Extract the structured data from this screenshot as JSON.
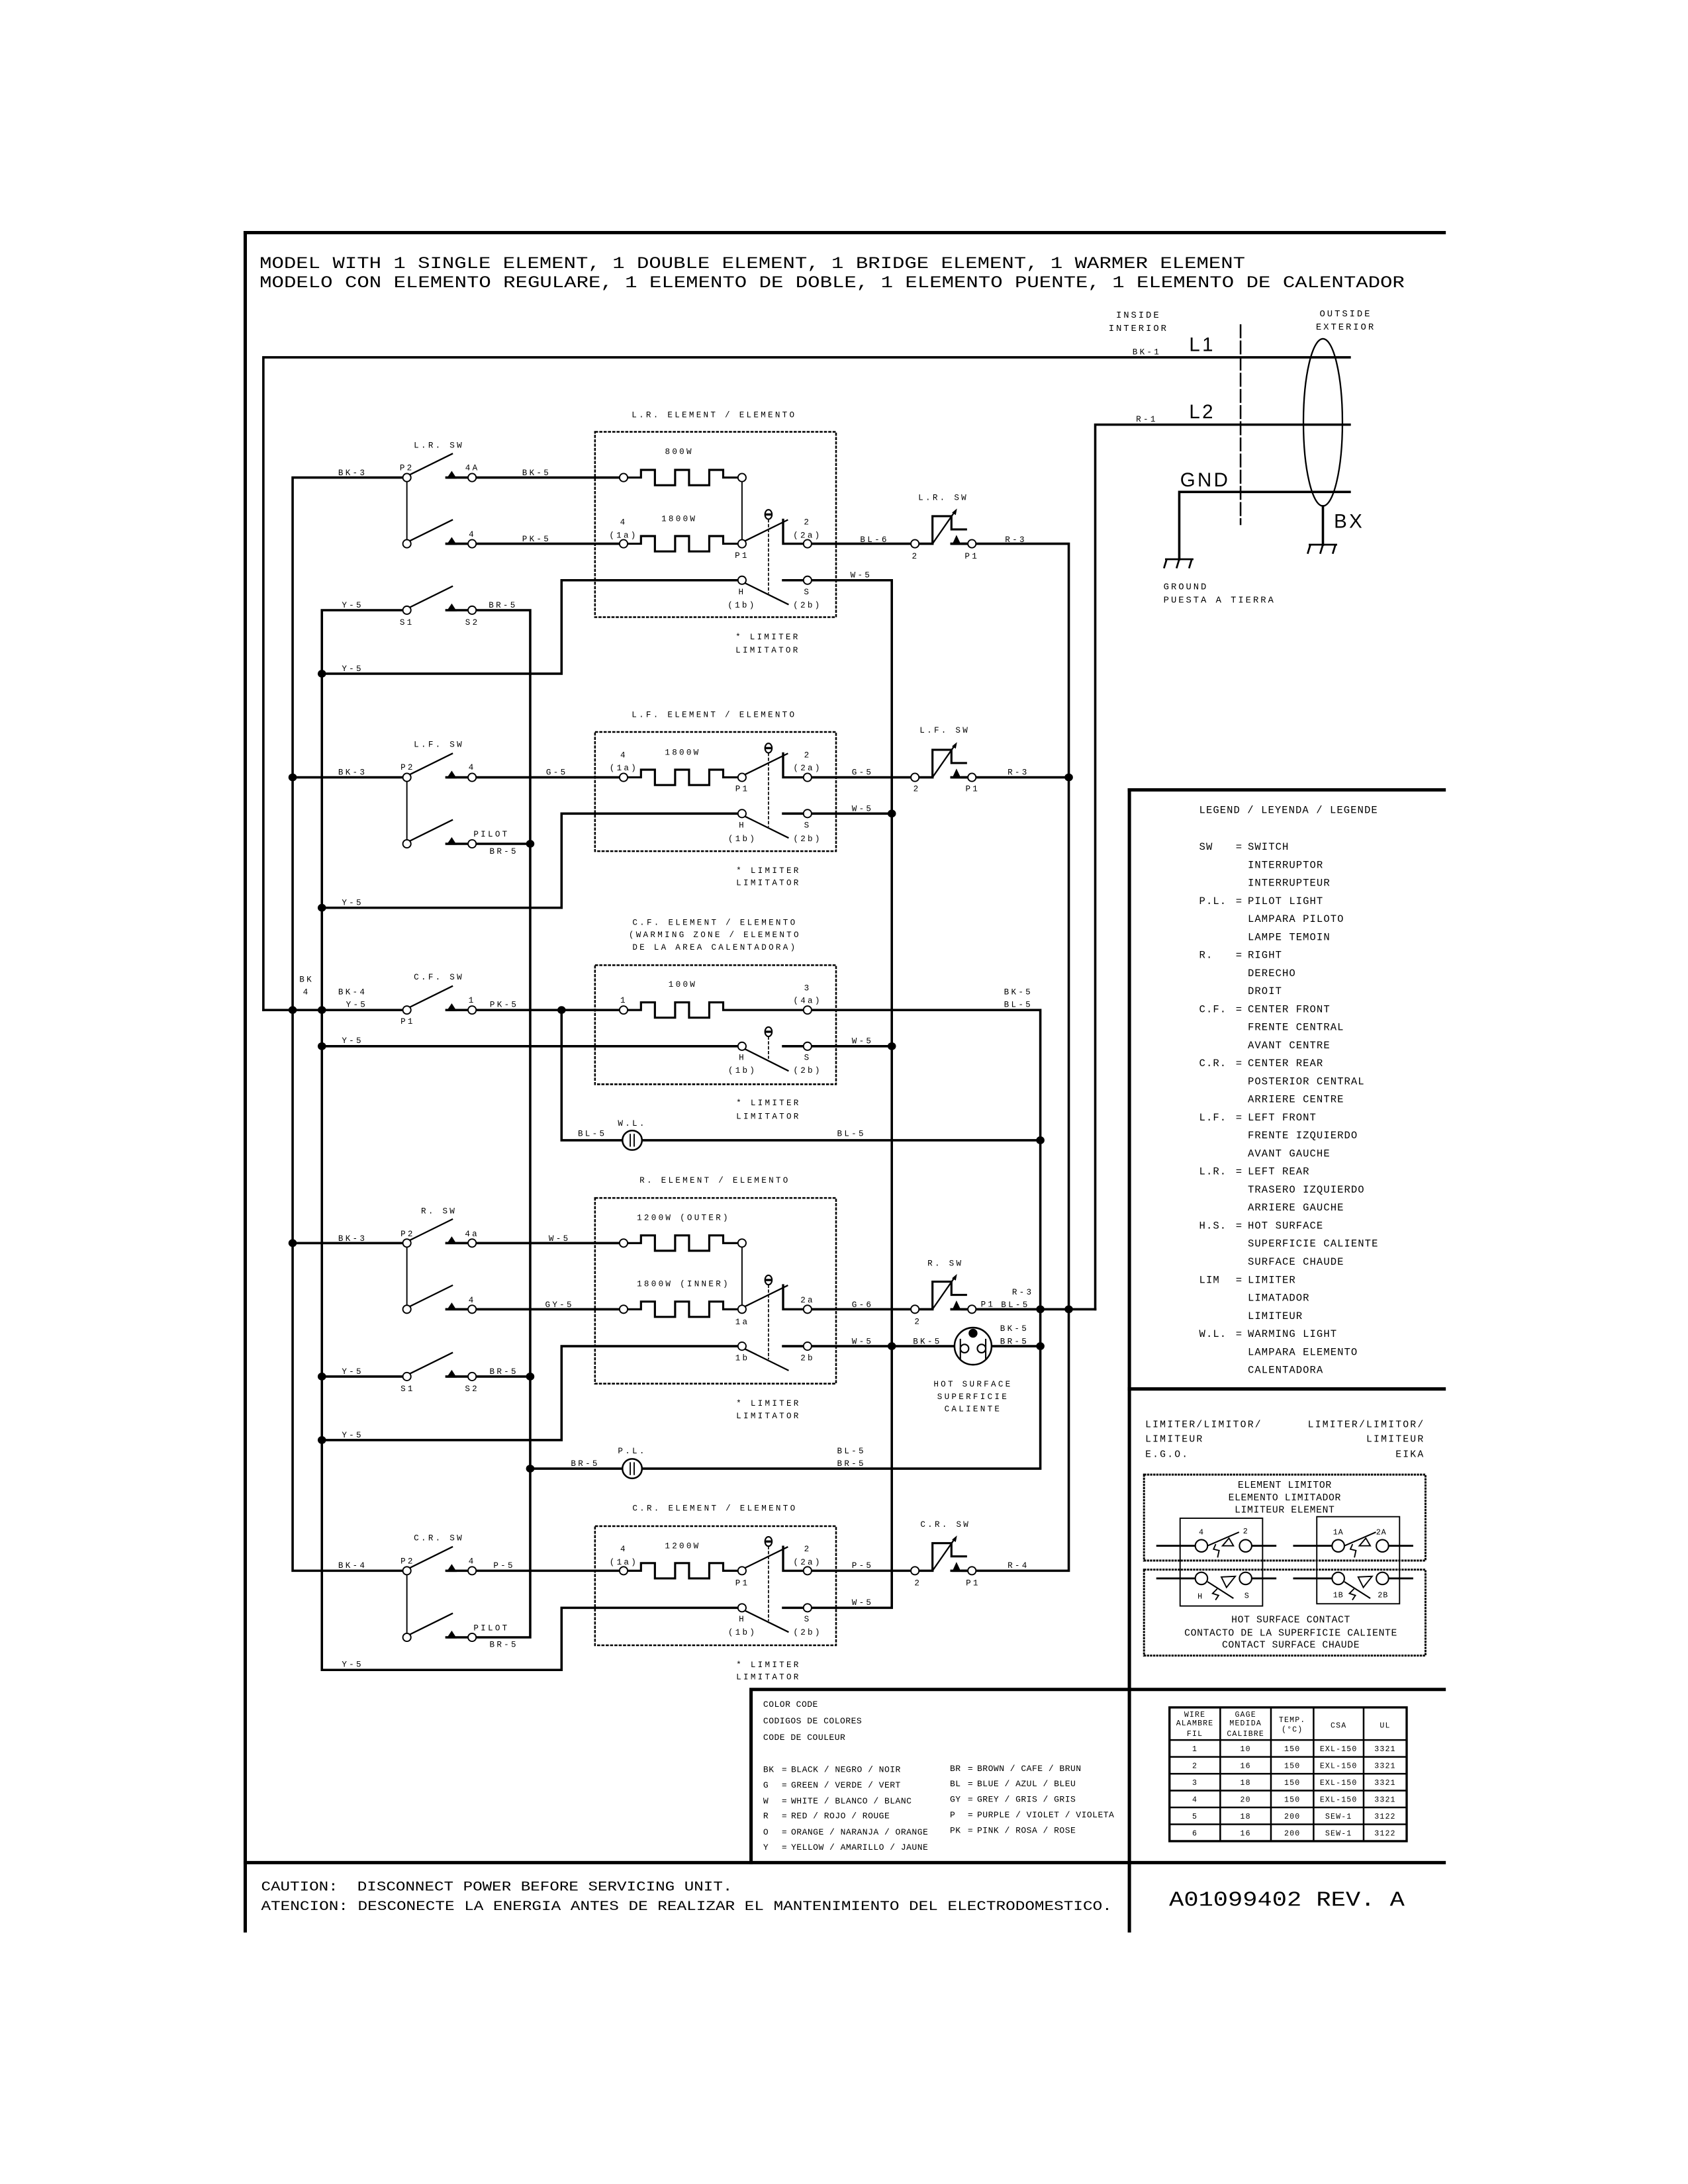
{
  "document": {
    "title_en": "MODEL WITH 1 SINGLE ELEMENT, 1 DOUBLE ELEMENT, 1 BRIDGE ELEMENT, 1 WARMER ELEMENT",
    "title_es": "MODELO CON ELEMENTO REGULARE, 1 ELEMENTO DE DOBLE, 1 ELEMENTO PUENTE, 1 ELEMENTO DE CALENTADOR",
    "caution_en": "CAUTION:  DISCONNECT POWER BEFORE SERVICING UNIT.",
    "caution_es": "ATENCION: DESCONECTE LA ENERGIA ANTES DE REALIZAR EL MANTENIMIENTO DEL ELECTRODOMESTICO.",
    "part_number": "A01099402 REV. A"
  },
  "power": {
    "inside": [
      "INSIDE",
      "INTERIOR"
    ],
    "outside": [
      "OUTSIDE",
      "EXTERIOR"
    ],
    "l1": "L1",
    "l1_wire": "BK-1",
    "l2": "L2",
    "l2_wire": "R-1",
    "gnd": "GND",
    "bx": "BX",
    "ground": [
      "GROUND",
      "PUESTA A TIERRA"
    ]
  },
  "sections": {
    "lr": {
      "title": "L.R. ELEMENT / ELEMENTO",
      "switch": "L.R. SW",
      "thermo_switch": "L.R. SW",
      "heaters": [
        "800W",
        "1800W"
      ],
      "wires": {
        "bus_in": "BK-3",
        "to_outer": "BK-5",
        "to_inner": "PK-5",
        "out": "BL-6",
        "return": "R-3",
        "neutral": "W-5",
        "sense_in": "Y-5",
        "sense_out": "BR-5",
        "sense_bottom": "Y-5"
      },
      "terminals": {
        "switch_p2": "P2",
        "switch_outer": "4A",
        "switch_inner": "4",
        "elem_in": "4",
        "elem_in_alt": "(1a)",
        "elem_p1": "P1",
        "elem_out": "2",
        "elem_out_alt": "(2a)",
        "h": "H",
        "h_alt": "(1b)",
        "s": "S",
        "s_alt": "(2b)",
        "s1": "S1",
        "s2": "S2",
        "thermo_in": "2",
        "thermo_out": "P1"
      },
      "limiter_note": [
        "* LIMITER",
        "LIMITATOR"
      ]
    },
    "lf": {
      "title": "L.F. ELEMENT / ELEMENTO",
      "switch": "L.F. SW",
      "thermo_switch": "L.F. SW",
      "heaters": [
        "1800W"
      ],
      "wires": {
        "bus_in": "BK-3",
        "to_elem": "G-5",
        "out": "G-5",
        "return": "R-3",
        "neutral": "W-5",
        "pilot": "BR-5",
        "sense_bottom": "Y-5"
      },
      "terminals": {
        "switch_p2": "P2",
        "switch_out": "4",
        "pilot": "PILOT",
        "elem_in": "4",
        "elem_in_alt": "(1a)",
        "elem_p1": "P1",
        "elem_out": "2",
        "elem_out_alt": "(2a)",
        "h": "H",
        "h_alt": "(1b)",
        "s": "S",
        "s_alt": "(2b)",
        "thermo_in": "2",
        "thermo_out": "P1"
      },
      "limiter_note": [
        "* LIMITER",
        "LIMITATOR"
      ]
    },
    "cf": {
      "title": [
        "C.F. ELEMENT / ELEMENTO",
        "(WARMING ZONE / ELEMENTO",
        "DE LA AREA CALENTADORA)"
      ],
      "switch": "C.F. SW",
      "heaters": [
        "100W"
      ],
      "bus_label": [
        "BK",
        "4"
      ],
      "wires": {
        "bus_in": "BK-4",
        "bus_in_2": "Y-5",
        "to_elem": "PK-5",
        "out": [
          "BK-5",
          "BL-5"
        ],
        "h_wire": "Y-5",
        "neutral": "W-5"
      },
      "terminals": {
        "switch_p1": "P1",
        "switch_out": "1",
        "elem_in": "1",
        "elem_out": "3",
        "elem_out_alt": "(4a)",
        "h": "H",
        "h_alt": "(1b)",
        "s": "S",
        "s_alt": "(2b)"
      },
      "limiter_note": [
        "* LIMITER",
        "LIMITATOR"
      ],
      "warming_light": {
        "label": "W.L.",
        "wire_in": "BL-5",
        "wire_out": "BL-5"
      }
    },
    "r": {
      "title": "R. ELEMENT / ELEMENTO",
      "switch": "R. SW",
      "thermo_switch": "R. SW",
      "heaters": [
        "1200W (OUTER)",
        "1800W (INNER)"
      ],
      "wires": {
        "bus_in": "BK-3",
        "to_outer": "W-5",
        "to_inner": "GY-5",
        "out": "G-6",
        "return_top": "R-3",
        "return_bottom": "BL-5",
        "neutral": "W-5",
        "hs_in": "BK-5",
        "hs_out": [
          "BK-5",
          "BR-5"
        ],
        "sense_in": "Y-5",
        "sense_out": "BR-5",
        "sense_bottom": "Y-5"
      },
      "terminals": {
        "switch_p2": "P2",
        "switch_outer": "4a",
        "switch_inner": "4",
        "elem_p1": "1a",
        "elem_out": "2a",
        "h": "1b",
        "s": "2b",
        "s1": "S1",
        "s2": "S2",
        "thermo_in": "2",
        "thermo_out": "P1"
      },
      "hot_surface": [
        "HOT SURFACE",
        "SUPERFICIE",
        "CALIENTE"
      ],
      "limiter_note": [
        "* LIMITER",
        "LIMITATOR"
      ],
      "pilot_light": {
        "label": "P.L.",
        "wire_in": "BR-5",
        "wire_out": [
          "BL-5",
          "BR-5"
        ]
      }
    },
    "cr": {
      "title": "C.R. ELEMENT / ELEMENTO",
      "switch": "C.R. SW",
      "thermo_switch": "C.R. SW",
      "heaters": [
        "1200W"
      ],
      "wires": {
        "bus_in": "BK-4",
        "to_elem": "P-5",
        "out": "P-5",
        "return": "R-4",
        "neutral": "W-5",
        "pilot": "BR-5",
        "sense_bottom": "Y-5"
      },
      "terminals": {
        "switch_p2": "P2",
        "switch_out": "4",
        "pilot": "PILOT",
        "elem_in": "4",
        "elem_in_alt": "(1a)",
        "elem_p1": "P1",
        "elem_out": "2",
        "elem_out_alt": "(2a)",
        "h": "H",
        "h_alt": "(1b)",
        "s": "S",
        "s_alt": "(2b)",
        "thermo_in": "2",
        "thermo_out": "P1"
      },
      "limiter_note": [
        "* LIMITER",
        "LIMITATOR"
      ]
    }
  },
  "legend": {
    "title": "LEGEND / LEYENDA / LEGENDE",
    "separator": "=",
    "entries": [
      {
        "abbr": "SW",
        "lines": [
          "SWITCH",
          "INTERRUPTOR",
          "INTERRUPTEUR"
        ]
      },
      {
        "abbr": "P.L.",
        "lines": [
          "PILOT LIGHT",
          "LAMPARA PILOTO",
          "LAMPE TEMOIN"
        ]
      },
      {
        "abbr": "R.",
        "lines": [
          "RIGHT",
          "DERECHO",
          "DROIT"
        ]
      },
      {
        "abbr": "C.F.",
        "lines": [
          "CENTER FRONT",
          "FRENTE CENTRAL",
          "AVANT CENTRE"
        ]
      },
      {
        "abbr": "C.R.",
        "lines": [
          "CENTER REAR",
          "POSTERIOR CENTRAL",
          "ARRIERE CENTRE"
        ]
      },
      {
        "abbr": "L.F.",
        "lines": [
          "LEFT FRONT",
          "FRENTE IZQUIERDO",
          "AVANT GAUCHE"
        ]
      },
      {
        "abbr": "L.R.",
        "lines": [
          "LEFT REAR",
          "TRASERO IZQUIERDO",
          "ARRIERE GAUCHE"
        ]
      },
      {
        "abbr": "H.S.",
        "lines": [
          "HOT SURFACE",
          "SUPERFICIE CALIENTE",
          "SURFACE CHAUDE"
        ]
      },
      {
        "abbr": "LIM",
        "lines": [
          "LIMITER",
          "LIMATADOR",
          "LIMITEUR"
        ]
      },
      {
        "abbr": "W.L.",
        "lines": [
          "WARMING LIGHT",
          "LAMPARA ELEMENTO",
          "CALENTADORA"
        ]
      }
    ]
  },
  "limiter_types": {
    "ego": [
      "LIMITER/LIMITOR/",
      "LIMITEUR",
      "E.G.O."
    ],
    "eika": [
      "LIMITER/LIMITOR/",
      "LIMITEUR",
      "EIKA"
    ],
    "element_limitor": [
      "ELEMENT LIMITOR",
      "ELEMENTO LIMITADOR",
      "LIMITEUR ELEMENT"
    ],
    "hot_surface_contact": [
      "HOT SURFACE CONTACT",
      "CONTACTO DE LA SUPERFICIE CALIENTE",
      "CONTACT SURFACE CHAUDE"
    ],
    "ego_terminals": {
      "top": [
        "4",
        "2"
      ],
      "bottom": [
        "H",
        "S"
      ]
    },
    "eika_terminals": {
      "top": [
        "1A",
        "2A"
      ],
      "bottom": [
        "1B",
        "2B"
      ]
    }
  },
  "color_code": {
    "title": [
      "COLOR CODE",
      "CODIGOS DE COLORES",
      "CODE DE COULEUR"
    ],
    "separator": "=",
    "left": [
      {
        "abbr": "BK",
        "meaning": "BLACK / NEGRO / NOIR"
      },
      {
        "abbr": "G",
        "meaning": "GREEN / VERDE / VERT"
      },
      {
        "abbr": "W",
        "meaning": "WHITE / BLANCO / BLANC"
      },
      {
        "abbr": "R",
        "meaning": "RED / ROJO / ROUGE"
      },
      {
        "abbr": "O",
        "meaning": "ORANGE / NARANJA / ORANGE"
      },
      {
        "abbr": "Y",
        "meaning": "YELLOW / AMARILLO / JAUNE"
      }
    ],
    "right": [
      {
        "abbr": "BR",
        "meaning": "BROWN / CAFE / BRUN"
      },
      {
        "abbr": "BL",
        "meaning": "BLUE / AZUL / BLEU"
      },
      {
        "abbr": "GY",
        "meaning": "GREY / GRIS / GRIS"
      },
      {
        "abbr": "P",
        "meaning": "PURPLE / VIOLET / VIOLETA"
      },
      {
        "abbr": "PK",
        "meaning": "PINK / ROSA / ROSE"
      }
    ]
  },
  "wire_table": {
    "headers": [
      [
        "WIRE",
        "ALAMBRE",
        "FIL"
      ],
      [
        "GAGE",
        "MEDIDA",
        "CALIBRE"
      ],
      [
        "TEMP.",
        "(°C)"
      ],
      [
        "CSA"
      ],
      [
        "UL"
      ]
    ],
    "rows": [
      [
        "1",
        "10",
        "150",
        "EXL-150",
        "3321"
      ],
      [
        "2",
        "16",
        "150",
        "EXL-150",
        "3321"
      ],
      [
        "3",
        "18",
        "150",
        "EXL-150",
        "3321"
      ],
      [
        "4",
        "20",
        "150",
        "EXL-150",
        "3321"
      ],
      [
        "5",
        "18",
        "200",
        "SEW-1",
        "3122"
      ],
      [
        "6",
        "16",
        "200",
        "SEW-1",
        "3122"
      ]
    ]
  }
}
